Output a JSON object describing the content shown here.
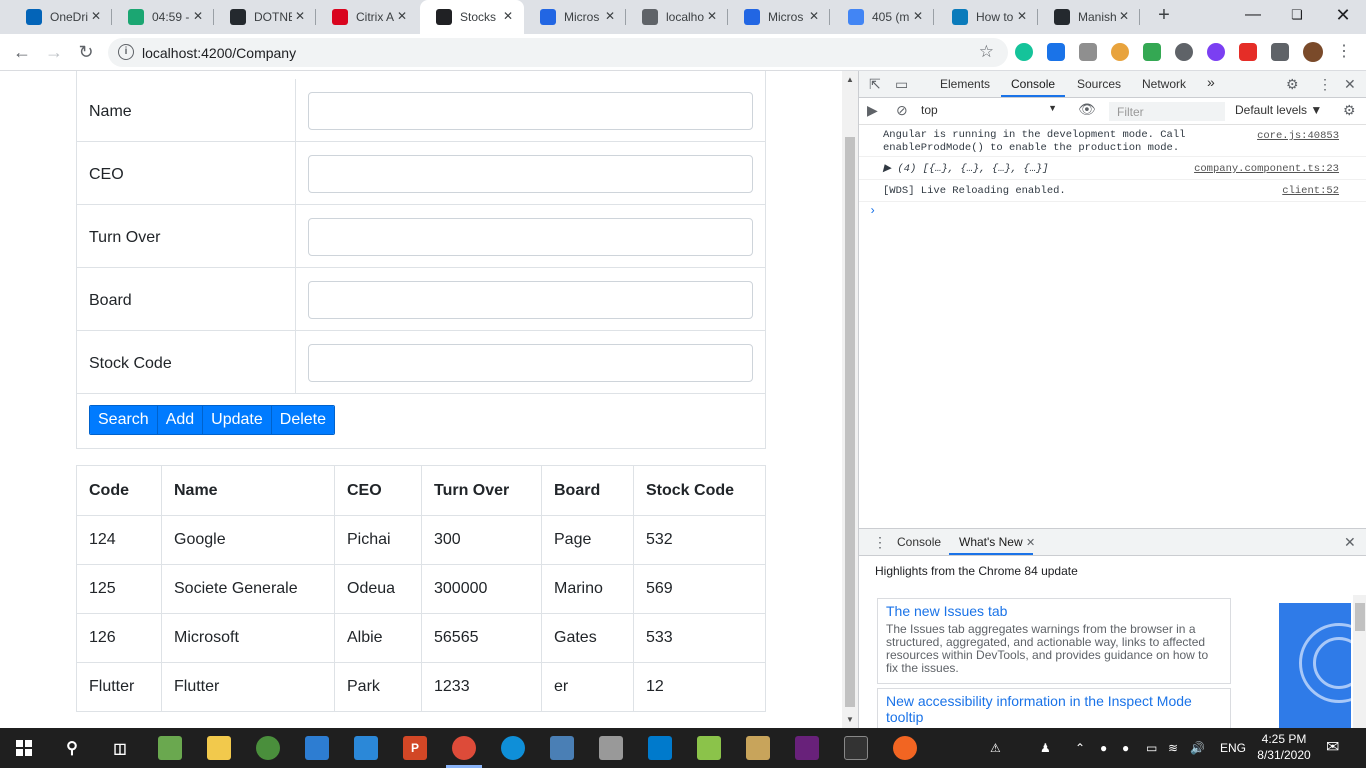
{
  "browser": {
    "tabs": [
      {
        "title": "OneDri",
        "icon": "onedrive-icon",
        "color": "#0364b8"
      },
      {
        "title": "04:59 -",
        "icon": "check-icon",
        "color": "#1ba672"
      },
      {
        "title": "DOTNE",
        "icon": "github-icon",
        "color": "#24292e"
      },
      {
        "title": "Citrix A",
        "icon": "citrix-icon",
        "color": "#d9041e"
      },
      {
        "title": "Stocks",
        "icon": "angular-icon",
        "color": "#202124"
      },
      {
        "title": "Micros",
        "icon": "learn-icon",
        "color": "#2266e3"
      },
      {
        "title": "localho",
        "icon": "globe-icon",
        "color": "#5f6368"
      },
      {
        "title": "Micros",
        "icon": "learn-icon",
        "color": "#2266e3"
      },
      {
        "title": "405 (m",
        "icon": "google-icon",
        "color": "#4285f4"
      },
      {
        "title": "How to",
        "icon": "kite-icon",
        "color": "#0a7bbb"
      },
      {
        "title": "Manish",
        "icon": "github-icon",
        "color": "#24292e"
      }
    ],
    "url": "localhost:4200/Company"
  },
  "form": {
    "fields": [
      {
        "label": "Name",
        "value": ""
      },
      {
        "label": "CEO",
        "value": ""
      },
      {
        "label": "Turn Over",
        "value": ""
      },
      {
        "label": "Board",
        "value": ""
      },
      {
        "label": "Stock Code",
        "value": ""
      }
    ],
    "buttons": {
      "search": "Search",
      "add": "Add",
      "update": "Update",
      "delete": "Delete"
    }
  },
  "table": {
    "headers": [
      "Code",
      "Name",
      "CEO",
      "Turn Over",
      "Board",
      "Stock Code"
    ],
    "rows": [
      [
        "124",
        "Google",
        "Pichai",
        "300",
        "Page",
        "532"
      ],
      [
        "125",
        "Societe Generale",
        "Odeua",
        "300000",
        "Marino",
        "569"
      ],
      [
        "126",
        "Microsoft",
        "Albie",
        "56565",
        "Gates",
        "533"
      ],
      [
        "Flutter",
        "Flutter",
        "Park",
        "1233",
        "er",
        "12"
      ]
    ]
  },
  "devtools": {
    "tabs": {
      "elements": "Elements",
      "console": "Console",
      "sources": "Sources",
      "network": "Network",
      "more": "»"
    },
    "context": "top",
    "filter_placeholder": "Filter",
    "levels": "Default levels ▼",
    "messages": [
      {
        "text": "Angular is running in the development mode. Call\nenableProdMode() to enable the production mode.",
        "source": "core.js:40853"
      },
      {
        "text": "▶ (4) [{…}, {…}, {…}, {…}]",
        "source": "company.component.ts:23"
      },
      {
        "text": "[WDS] Live Reloading enabled.",
        "source": "client:52"
      }
    ],
    "prompt": "›",
    "drawer": {
      "tab_console": "Console",
      "tab_whats_new": "What's New",
      "highlights": "Highlights from the Chrome 84 update",
      "cards": [
        {
          "title": "The new Issues tab",
          "body": "The Issues tab aggregates warnings from the browser in a structured, aggregated, and actionable way, links to affected resources within DevTools, and provides guidance on how to fix the issues."
        },
        {
          "title": "New accessibility information in the Inspect Mode tooltip",
          "body": ""
        }
      ]
    }
  },
  "taskbar": {
    "lang": "ENG",
    "time": "4:25 PM",
    "date": "8/31/2020"
  }
}
